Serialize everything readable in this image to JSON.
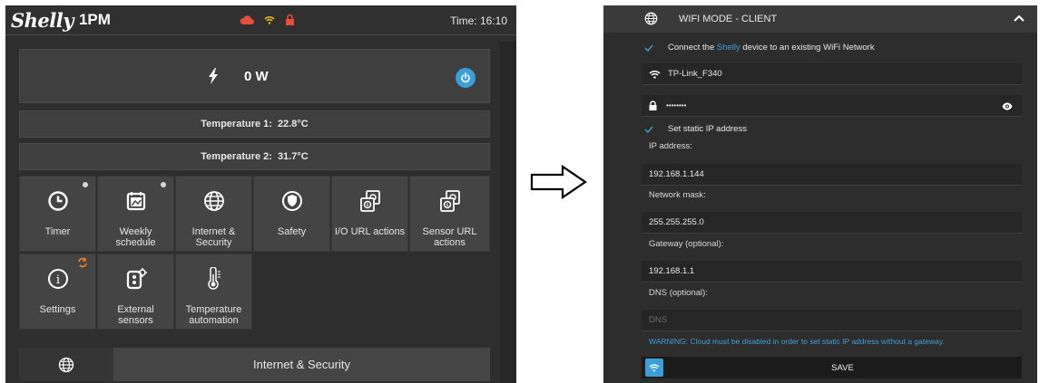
{
  "left_panel": {
    "header": {
      "logo_script": "Shelly",
      "logo_model": "1PM",
      "status_icons": [
        "cloud-icon",
        "wifi-icon",
        "lock-icon"
      ],
      "time_label": "Time:",
      "time_value": "16:10"
    },
    "power": {
      "value": "0 W",
      "bolt_icon": "bolt-icon",
      "button_icon": "power-icon"
    },
    "temperatures": [
      {
        "label": "Temperature 1:",
        "value": "22.8°C"
      },
      {
        "label": "Temperature 2:",
        "value": "31.7°C"
      }
    ],
    "tiles": [
      {
        "label": "Timer",
        "icon": "clock-icon",
        "indicator": "dot"
      },
      {
        "label": "Weekly schedule",
        "icon": "calendar-icon",
        "indicator": "dot"
      },
      {
        "label": "Internet & Security",
        "icon": "globe-icon"
      },
      {
        "label": "Safety",
        "icon": "shield-icon"
      },
      {
        "label": "I/O URL actions",
        "icon": "url-actions-icon"
      },
      {
        "label": "Sensor URL actions",
        "icon": "url-actions-icon"
      },
      {
        "label": "Settings",
        "icon": "info-icon",
        "indicator": "sync"
      },
      {
        "label": "External sensors",
        "icon": "sensor-icon"
      },
      {
        "label": "Temperature automation",
        "icon": "thermometer-icon"
      }
    ],
    "bottom_bar": {
      "label": "Internet & Security",
      "icon": "globe-icon"
    }
  },
  "arrow_icon": "right-arrow-icon",
  "right_panel": {
    "section_title": "WIFI MODE - CLIENT",
    "connect": {
      "prefix": "Connect the",
      "link": "Shelly",
      "suffix": "device to an existing WiFi Network",
      "checked": true
    },
    "ssid": "TP-Link_F340",
    "password": "••••••••",
    "static_ip": {
      "label": "Set static IP address",
      "checked": true
    },
    "ip_address": {
      "label": "IP address:",
      "value": "192.168.1.144"
    },
    "network_mask": {
      "label": "Network mask:",
      "value": "255.255.255.0"
    },
    "gateway": {
      "label": "Gateway (optional):",
      "value": "192.168.1.1"
    },
    "dns": {
      "label": "DNS (optional):",
      "placeholder": "DNS"
    },
    "warning": "WARNING: Cloud must be disabled in order to set static IP address without a gateway.",
    "save_label": "SAVE"
  },
  "colors": {
    "accent": "#3b9fd9",
    "cloud": "#e74c3c",
    "wifi": "#f1c40f",
    "lock": "#e74c3c",
    "sync": "#e67e22"
  }
}
